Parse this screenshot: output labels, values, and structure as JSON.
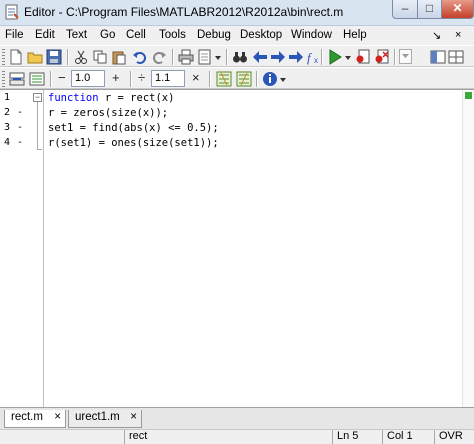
{
  "window": {
    "title": "Editor - C:\\Program Files\\MATLABR2012\\R2012a\\bin\\rect.m",
    "min_glyph": "–",
    "max_glyph": "□",
    "close_glyph": "✕"
  },
  "menu": {
    "items": [
      "File",
      "Edit",
      "Text",
      "Go",
      "Cell",
      "Tools",
      "Debug",
      "Desktop",
      "Window",
      "Help"
    ],
    "dock_glyph": "↘",
    "close_glyph": "×"
  },
  "toolbar2": {
    "minus_glyph": "−",
    "increment_value": "1.0",
    "plus_glyph": "+",
    "divide_glyph": "÷",
    "divide_value": "1.1",
    "times_glyph": "×"
  },
  "editor": {
    "line_numbers": [
      "1",
      "2",
      "3",
      "4"
    ],
    "line_markers": [
      "",
      "-",
      "-",
      "-"
    ],
    "lines": [
      {
        "keyword": "function",
        "rest": " r = rect(x)"
      },
      {
        "keyword": "",
        "rest": "r = zeros(size(x));"
      },
      {
        "keyword": "",
        "rest": "set1 = find(abs(x) <= 0.5);"
      },
      {
        "keyword": "",
        "rest": "r(set1) = ones(size(set1));"
      }
    ]
  },
  "tabs": [
    {
      "label": "rect.m",
      "close": "×",
      "active": true
    },
    {
      "label": "urect1.m",
      "close": "×",
      "active": false
    }
  ],
  "status": {
    "function_name": "rect",
    "line": "Ln  5",
    "col": "Col  1",
    "mode": "OVR"
  },
  "colors": {
    "keyword": "#0000ff",
    "title_bar": "#d9e4f1",
    "close_button": "#c4402a"
  }
}
